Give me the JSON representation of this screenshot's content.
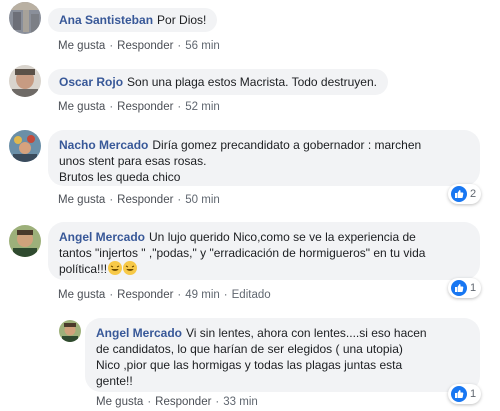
{
  "comments": [
    {
      "author": "Ana Santisteban",
      "text": "Por Dios!",
      "like": "Me gusta",
      "reply": "Responder",
      "time": "56 min"
    },
    {
      "author": "Oscar Rojo",
      "text": "Son una plaga estos Macrista. Todo destruyen.",
      "like": "Me gusta",
      "reply": "Responder",
      "time": "52 min"
    },
    {
      "author": "Nacho Mercado",
      "text_line1": "Diría gomez precandidato a gobernador : marchen",
      "text_line2": "unos stent para esas rosas.",
      "text_line3": "Brutos les queda chico",
      "like": "Me gusta",
      "reply": "Responder",
      "time": "50 min",
      "reactions": "2"
    },
    {
      "author": "Angel Mercado",
      "text_line1": "Un lujo querido Nico,como se ve la experiencia de",
      "text_line2": "tantos \"injertos \" ,\"podas,\" y \"erradicación de hormigueros\" en tu vida",
      "text_line3": "política!!!",
      "like": "Me gusta",
      "reply": "Responder",
      "time": "49 min",
      "edited": "Editado",
      "reactions": "1"
    },
    {
      "author": "Angel Mercado",
      "text_line1": "Vi sin lentes, ahora con lentes....si eso hacen",
      "text_line2": "de candidatos, lo que harían de ser elegidos ( una utopia)",
      "text_line3": "Nico ,pior que las hormigas y todas las plagas juntas esta",
      "text_line4": "gente!!",
      "like": "Me gusta",
      "reply": "Responder",
      "time": "33 min",
      "reactions": "1"
    }
  ],
  "icons": {
    "like": "thumbs-up-icon",
    "laugh": "laughing-emoji-icon"
  },
  "colors": {
    "author": "#385898",
    "bubble": "#f2f3f5",
    "like_blue": "#1877f2"
  }
}
